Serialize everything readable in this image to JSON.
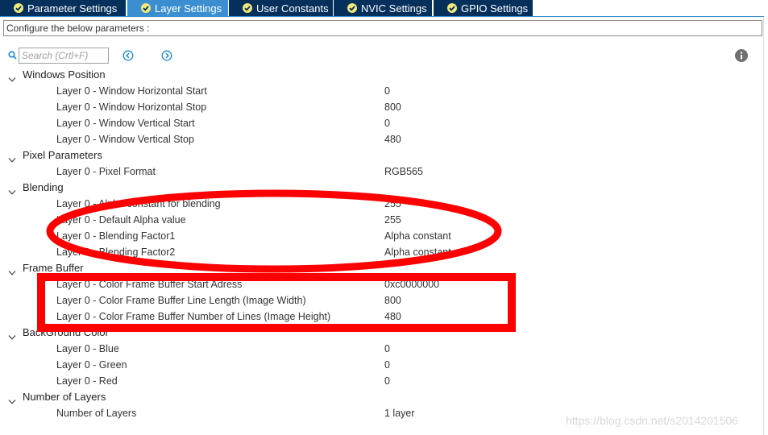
{
  "tabs": [
    {
      "label": "Parameter Settings",
      "active": false
    },
    {
      "label": "Layer Settings",
      "active": true
    },
    {
      "label": "User Constants",
      "active": false
    },
    {
      "label": "NVIC Settings",
      "active": false
    },
    {
      "label": "GPIO Settings",
      "active": false
    }
  ],
  "config_label": "Configure the below parameters :",
  "search": {
    "placeholder": "Search (Crtl+F)"
  },
  "groups": [
    {
      "title": "Windows Position",
      "params": [
        {
          "name": "Layer 0 - Window Horizontal Start",
          "value": "0"
        },
        {
          "name": "Layer 0 - Window Horizontal Stop",
          "value": "800"
        },
        {
          "name": "Layer 0 - Window Vertical Start",
          "value": "0"
        },
        {
          "name": "Layer 0 - Window Vertical Stop",
          "value": "480"
        }
      ]
    },
    {
      "title": "Pixel Parameters",
      "params": [
        {
          "name": "Layer 0 - Pixel Format",
          "value": "RGB565"
        }
      ]
    },
    {
      "title": "Blending",
      "params": [
        {
          "name": "Layer 0 - Alpha constant for blending",
          "value": "255"
        },
        {
          "name": "Layer 0 - Default Alpha value",
          "value": "255"
        },
        {
          "name": "Layer 0 - Blending Factor1",
          "value": "Alpha constant"
        },
        {
          "name": "Layer 0 - Blending Factor2",
          "value": "Alpha constant"
        }
      ]
    },
    {
      "title": "Frame Buffer",
      "params": [
        {
          "name": "Layer 0 - Color Frame Buffer Start Adress",
          "value": "0xc0000000"
        },
        {
          "name": "Layer 0 - Color Frame Buffer Line Length (Image Width)",
          "value": "800"
        },
        {
          "name": "Layer 0 - Color Frame Buffer Number of Lines (Image Height)",
          "value": "480"
        }
      ]
    },
    {
      "title": "BackGround Color",
      "params": [
        {
          "name": "Layer 0 - Blue",
          "value": "0"
        },
        {
          "name": "Layer 0 - Green",
          "value": "0"
        },
        {
          "name": "Layer 0 - Red",
          "value": "0"
        }
      ]
    },
    {
      "title": "Number of Layers",
      "params": [
        {
          "name": "Number of Layers",
          "value": "1 layer"
        }
      ]
    }
  ],
  "watermark": "https://blog.csdn.net/s2014201506",
  "colors": {
    "tab_bg": "#05305c",
    "tab_active": "#3b8fd0",
    "annotation": "#ff0000"
  },
  "icons": {
    "tab_status": "check-circle-icon",
    "search": "search-icon",
    "prev": "arrow-left-circle-icon",
    "next": "arrow-right-circle-icon",
    "info": "info-icon",
    "expander": "chevron-down-icon"
  }
}
